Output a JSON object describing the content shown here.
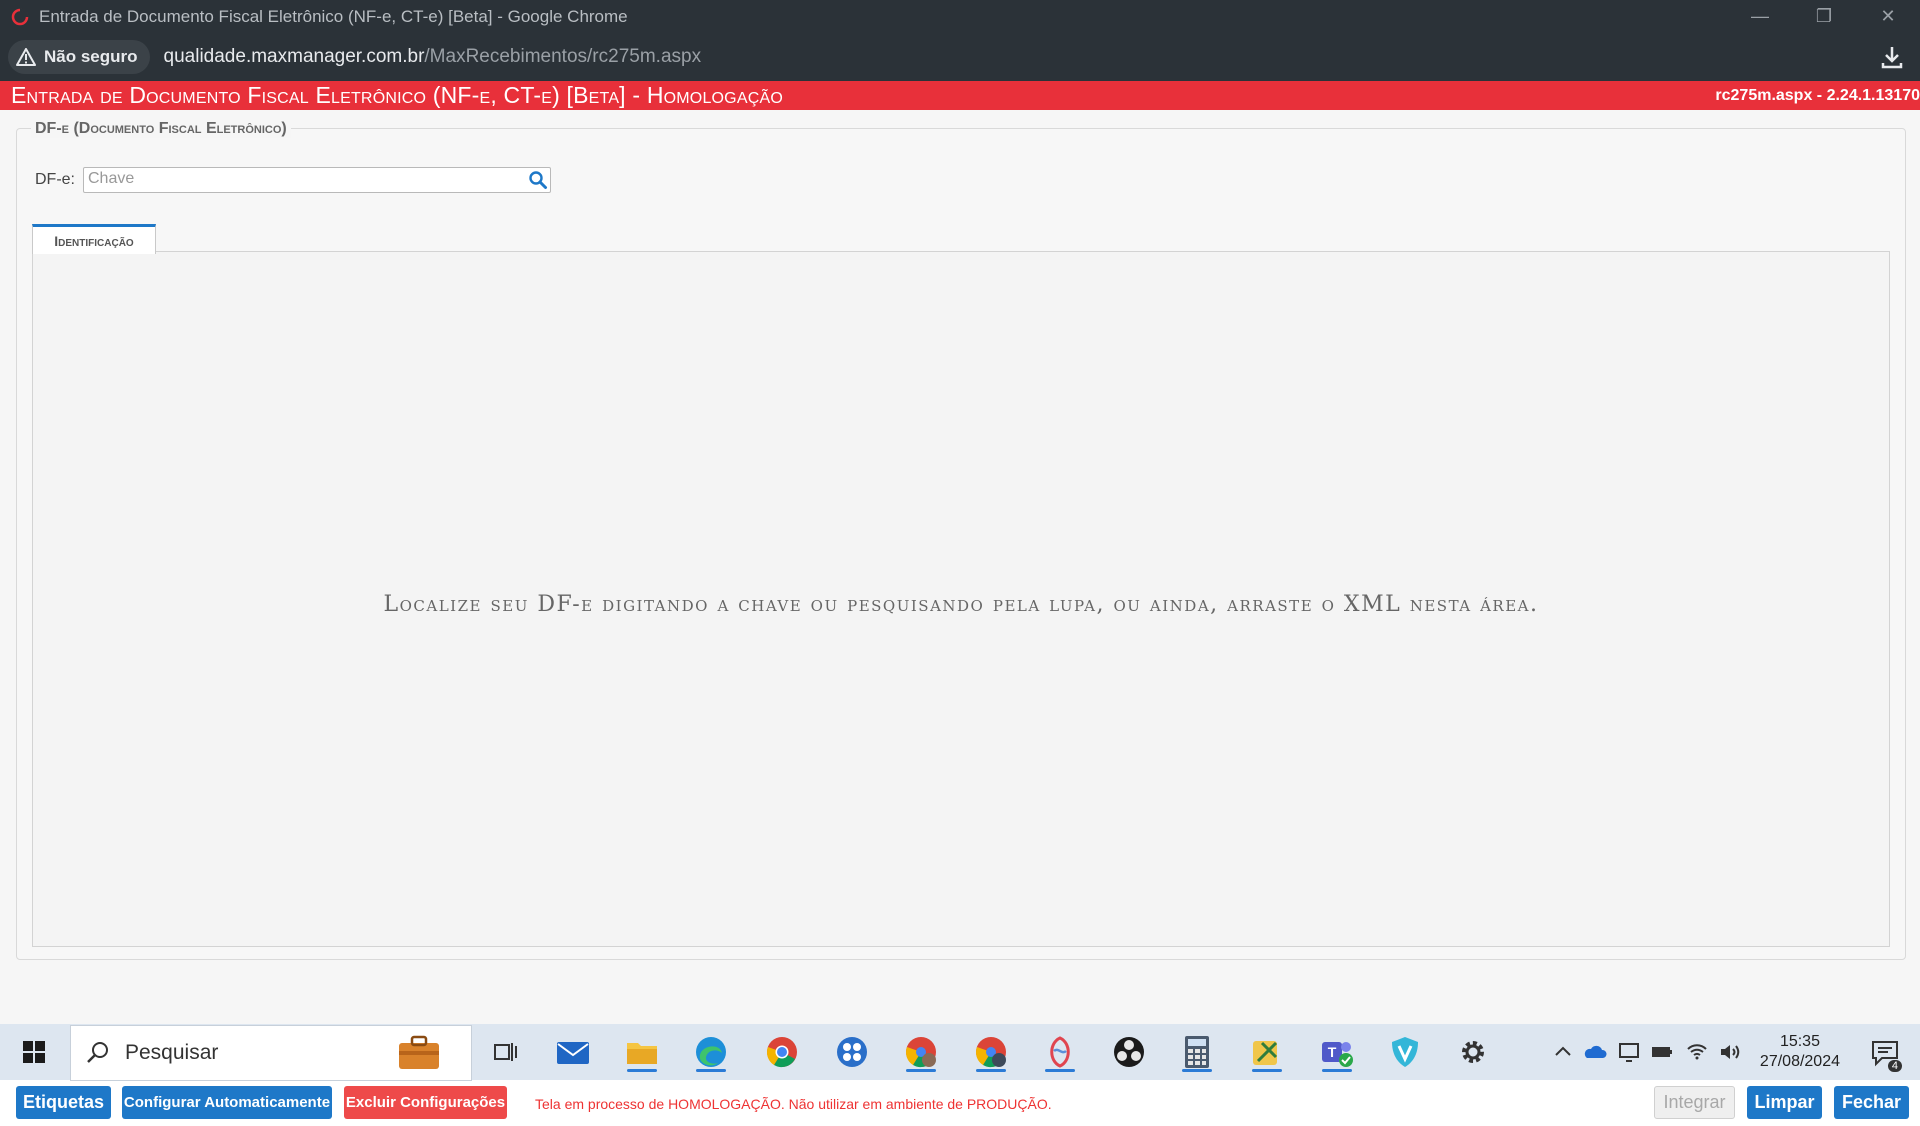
{
  "browser": {
    "window_title": "Entrada de Documento Fiscal Eletrônico (NF-e, CT-e) [Beta] - Google Chrome",
    "security_label": "Não seguro",
    "url_domain": "qualidade.maxmanager.com.br",
    "url_path": "/MaxRecebimentos/rc275m.aspx"
  },
  "app": {
    "page_title": "Entrada de Documento Fiscal Eletrônico (NF-e, CT-e) [Beta]   - Homologação",
    "version": "rc275m.aspx - 2.24.1.13170",
    "header_color": "#e8303a"
  },
  "form": {
    "legend": "DF-e (Documento Fiscal Eletrônico)",
    "dfe_label": "DF-e:",
    "key_placeholder": "Chave",
    "key_value": ""
  },
  "tabs": [
    {
      "label": "Identificação",
      "active": true
    }
  ],
  "panel": {
    "drop_hint": "Localize seu DF-e digitando a chave ou pesquisando pela lupa, ou ainda, arraste o XML nesta área."
  },
  "footer": {
    "btn_etiquetas": "Etiquetas",
    "btn_configurar": "Configurar Automaticamente",
    "btn_excluir": "Excluir Configurações",
    "warning": "Tela em processo de HOMOLOGAÇÃO. Não utilizar em ambiente de PRODUÇÃO.",
    "btn_integrar": "Integrar",
    "btn_limpar": "Limpar",
    "btn_fechar": "Fechar"
  },
  "taskbar": {
    "search_placeholder": "Pesquisar",
    "time": "15:35",
    "date": "27/08/2024",
    "notification_count": "4",
    "apps": [
      "briefcase-app",
      "task-view",
      "mail",
      "file-explorer",
      "edge",
      "chrome",
      "app-grid",
      "chrome-profile-1",
      "chrome-profile-2",
      "stylus-app",
      "obs",
      "calculator",
      "tools-app",
      "teams",
      "shield-app",
      "settings"
    ]
  },
  "colors": {
    "accent_blue": "#1e78c8",
    "danger_red": "#ee4a4a",
    "warning_text": "#e33333"
  }
}
